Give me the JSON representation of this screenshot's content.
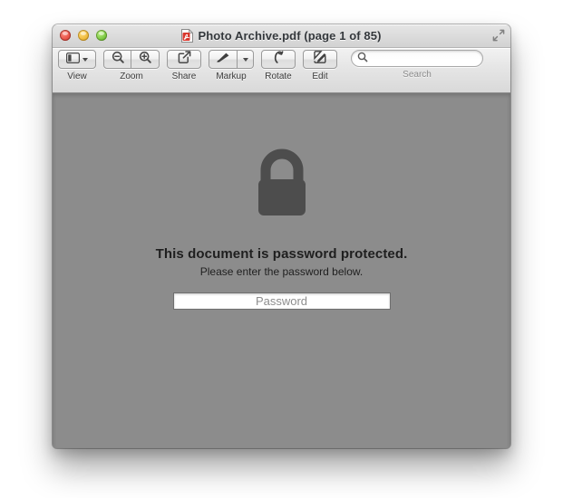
{
  "window": {
    "title": "Photo Archive.pdf (page 1 of 85)",
    "document_name": "Photo Archive.pdf",
    "page_current": 1,
    "page_total": 85,
    "file_type_icon": "pdf-file-icon",
    "traffic_lights": [
      {
        "name": "close-button",
        "color": "#e9564a"
      },
      {
        "name": "minimize-button",
        "color": "#f0bc3f"
      },
      {
        "name": "maximize-button",
        "color": "#7dc944"
      }
    ],
    "fullscreen_icon": "fullscreen-expand-icon"
  },
  "toolbar": {
    "items": [
      {
        "label": "View",
        "icon": "sidebar-panel-icon",
        "has_caret": true
      },
      {
        "label": "Zoom",
        "icon": "zoom-out-icon",
        "icon2": "zoom-in-icon"
      },
      {
        "label": "Share",
        "icon": "share-export-icon"
      },
      {
        "label": "Markup",
        "icon": "markup-pen-icon",
        "has_caret": true
      },
      {
        "label": "Rotate",
        "icon": "rotate-left-icon"
      },
      {
        "label": "Edit",
        "icon": "edit-pencil-icon"
      }
    ],
    "search": {
      "label": "Search",
      "value": "",
      "placeholder": "",
      "icon": "search-magnifier-icon"
    }
  },
  "content": {
    "lock_icon": "padlock-locked-icon",
    "message_primary": "This document is password protected.",
    "message_secondary": "Please enter the password below.",
    "password": {
      "value": "",
      "placeholder": "Password"
    }
  },
  "colors": {
    "content_background": "#8c8c8c",
    "lock": "#4d4d4d",
    "toolbar_top": "#f2f2f2",
    "toolbar_bottom": "#d9d9d9"
  }
}
